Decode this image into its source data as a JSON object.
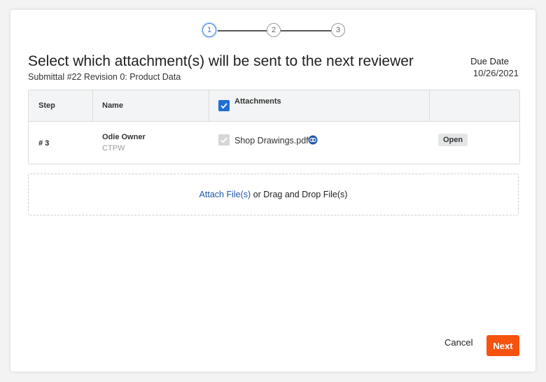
{
  "stepper": {
    "steps": [
      "1",
      "2",
      "3"
    ],
    "active_index": 0
  },
  "header": {
    "title": "Select which attachment(s) will be sent to the next reviewer",
    "subtitle": "Submittal #22 Revision 0: Product Data",
    "due_label": "Due Date",
    "due_value": "10/26/2021"
  },
  "table": {
    "columns": [
      "Step",
      "Name",
      "Attachments"
    ],
    "select_all_checked": true,
    "rows": [
      {
        "step": "# 3",
        "name": "Odie Owner",
        "company": "CTPW",
        "attachment": "Shop Drawings.pdf",
        "attachment_checked": true,
        "attachment_disabled": true,
        "attachment_icon": "compare-icon",
        "action_label": "Open"
      }
    ]
  },
  "dropzone": {
    "link_text": "Attach File(s)",
    "rest_text": " or Drag and Drop File(s)"
  },
  "footer": {
    "cancel_label": "Cancel",
    "next_label": "Next"
  },
  "colors": {
    "accent": "#1f6fd6",
    "primary_button": "#f5530f",
    "link": "#1f56a8"
  }
}
